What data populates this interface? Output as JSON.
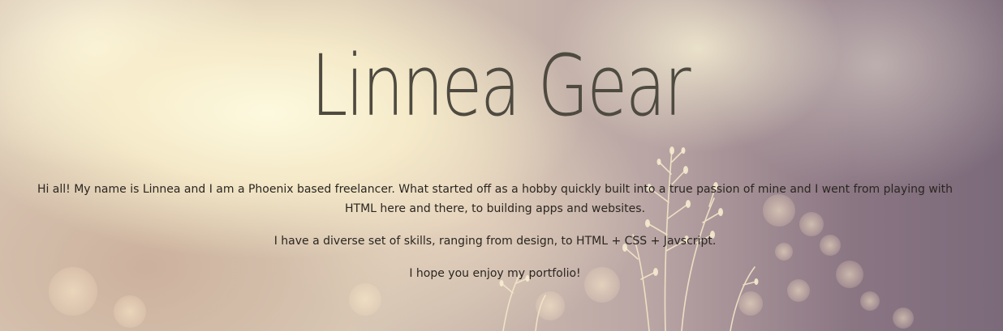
{
  "hero": {
    "title": "Linnea Gear",
    "paragraphs": [
      "Hi all! My name is Linnea and I am a Phoenix based freelancer. What started off as a hobby quickly built into a true passion of mine and I went from playing with HTML here and there, to building apps and websites.",
      "I have a diverse set of skills, ranging from design, to HTML + CSS + Javscript.",
      "I hope you enjoy my portfolio!"
    ]
  },
  "colors": {
    "title": "#4e4a40",
    "body_text": "#2a2620"
  }
}
